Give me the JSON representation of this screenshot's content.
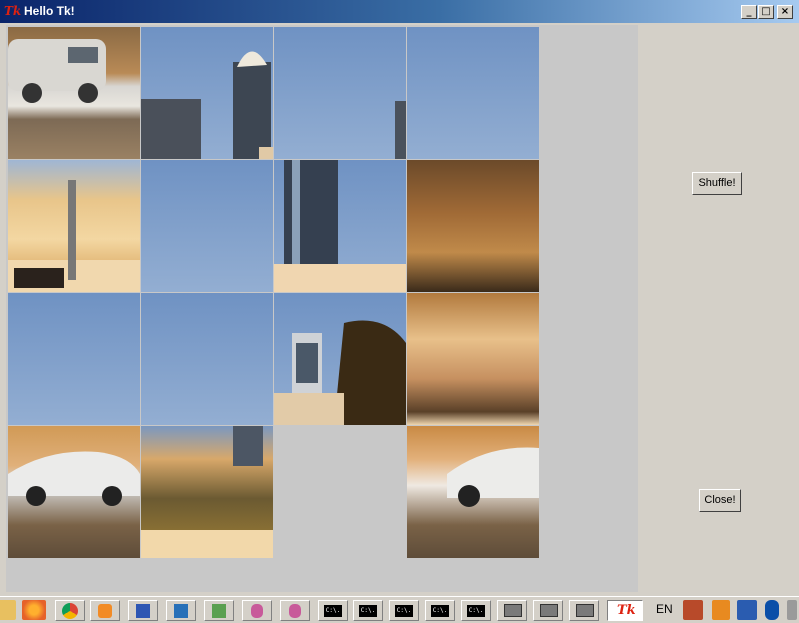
{
  "window": {
    "title": "Hello Tk!",
    "app_icon_text": "Tk",
    "controls": {
      "minimize": "_",
      "maximize": "□",
      "close": "×"
    }
  },
  "puzzle": {
    "tiles": [
      "car-rav4-in-lot",
      "twin-towers",
      "tower-edge",
      "plain-sky",
      "villa-arches",
      "plain-sky",
      "glass-tower-rooftop",
      "tree-shaded-villa",
      "plain-sky",
      "plain-sky",
      "palm-and-tower",
      "villa-balcony",
      "sedan-front",
      "tree-and-wall",
      "empty-slot",
      "sedan-rear"
    ]
  },
  "sidebar": {
    "shuffle_label": "Shuffle!",
    "close_label": "Close!"
  },
  "taskbar": {
    "active_app_label": "Tk",
    "language": "EN",
    "icon_names": [
      "folder-icon",
      "firefox-icon",
      "chrome-icon",
      "media-player-icon",
      "save-icon",
      "powershell-icon",
      "notepad-icon",
      "database-icon",
      "database-icon",
      "terminal-icon",
      "terminal-icon",
      "terminal-icon",
      "terminal-icon",
      "terminal-icon",
      "monitor-icon",
      "monitor-icon",
      "monitor-icon",
      "tk-icon",
      "network-icon",
      "warning-icon",
      "shield-icon",
      "bluetooth-icon",
      "printer-icon"
    ],
    "terminal_text": "C:\\."
  }
}
